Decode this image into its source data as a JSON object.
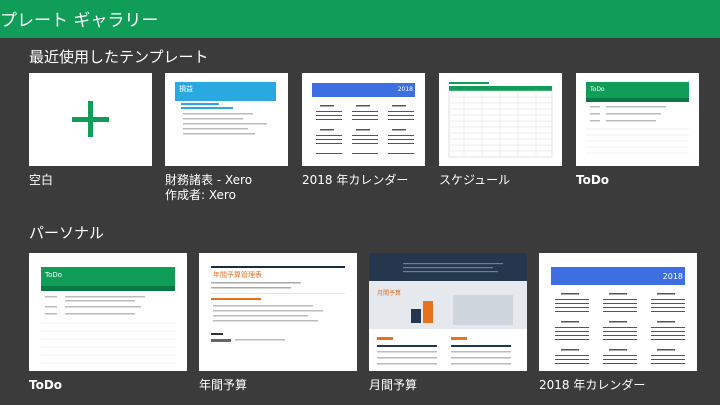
{
  "header": {
    "title": "プレート ギャラリー"
  },
  "sections": {
    "recent": {
      "title": "最近使用したテンプレート"
    },
    "personal": {
      "title": "パーソナル"
    }
  },
  "recent": [
    {
      "name": "空白"
    },
    {
      "name": "財務諸表 - Xero",
      "author": "作成者: Xero",
      "thumb_title": "損益"
    },
    {
      "name": "2018 年カレンダー",
      "thumb_year": "2018"
    },
    {
      "name": "スケジュール"
    },
    {
      "name": "ToDo",
      "thumb_title": "ToDo"
    }
  ],
  "personal": [
    {
      "name": "ToDo",
      "thumb_title": "ToDo"
    },
    {
      "name": "年間予算",
      "thumb_title": "年間予算管理表"
    },
    {
      "name": "月間予算",
      "thumb_title": "月間予算"
    },
    {
      "name": "2018 年カレンダー",
      "thumb_year": "2018"
    }
  ],
  "colors": {
    "header": "#0f9d58",
    "background": "#3b3b3b",
    "plus": "#0f9d58",
    "calendar_band": "#3d6fe0",
    "xero_band": "#2aa8e0"
  }
}
